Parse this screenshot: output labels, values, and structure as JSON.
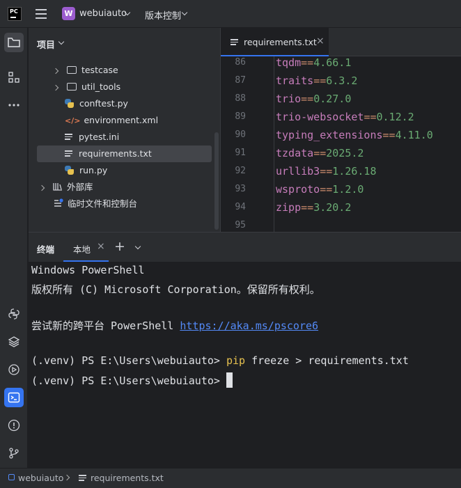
{
  "titlebar": {
    "logo_text": "PC",
    "project_initial": "W",
    "project_name": "webuiauto",
    "vcs_label": "版本控制"
  },
  "project_pane": {
    "title": "项目",
    "items": [
      {
        "label": "testcase",
        "type": "folder",
        "expandable": true
      },
      {
        "label": "util_tools",
        "type": "folder",
        "expandable": true
      },
      {
        "label": "conftest.py",
        "type": "python"
      },
      {
        "label": "environment.xml",
        "type": "xml"
      },
      {
        "label": "pytest.ini",
        "type": "text"
      },
      {
        "label": "requirements.txt",
        "type": "text",
        "selected": true
      },
      {
        "label": "run.py",
        "type": "python"
      },
      {
        "label": "外部库",
        "type": "library",
        "expandable": true
      },
      {
        "label": "临时文件和控制台",
        "type": "scratch"
      }
    ]
  },
  "editor": {
    "tab_label": "requirements.txt",
    "lines": [
      {
        "num": "86",
        "pkg": "tqdm",
        "op": "==",
        "ver": "4.66.1"
      },
      {
        "num": "87",
        "pkg": "traits",
        "op": "==",
        "ver": "6.3.2"
      },
      {
        "num": "88",
        "pkg": "trio",
        "op": "==",
        "ver": "0.27.0"
      },
      {
        "num": "89",
        "pkg": "trio-websocket",
        "op": "==",
        "ver": "0.12.2"
      },
      {
        "num": "90",
        "pkg": "typing_extensions",
        "op": "==",
        "ver": "4.11.0"
      },
      {
        "num": "91",
        "pkg": "tzdata",
        "op": "==",
        "ver": "2025.2"
      },
      {
        "num": "92",
        "pkg": "urllib3",
        "op": "==",
        "ver": "1.26.18"
      },
      {
        "num": "93",
        "pkg": "wsproto",
        "op": "==",
        "ver": "1.2.0"
      },
      {
        "num": "94",
        "pkg": "zipp",
        "op": "==",
        "ver": "3.20.2"
      },
      {
        "num": "95",
        "pkg": "",
        "op": "",
        "ver": ""
      }
    ]
  },
  "terminal": {
    "tab_title": "终端",
    "tab_local": "本地",
    "line1": "Windows PowerShell",
    "line2": "版权所有 (C) Microsoft Corporation。保留所有权利。",
    "line3_prefix": "尝试新的跨平台 PowerShell ",
    "line3_link": "https://aka.ms/pscore6",
    "prompt": "(.venv) PS E:\\Users\\webuiauto> ",
    "cmd_pip": "pip",
    "cmd_rest": " freeze > requirements.txt",
    "prompt2": "(.venv) PS E:\\Users\\webuiauto> "
  },
  "statusbar": {
    "project": "webuiauto",
    "file": "requirements.txt"
  },
  "colors": {
    "accent": "#3574f0",
    "package": "#c77dbb",
    "operator": "#cf8e6d",
    "version": "#6aab73",
    "link": "#548af7"
  }
}
